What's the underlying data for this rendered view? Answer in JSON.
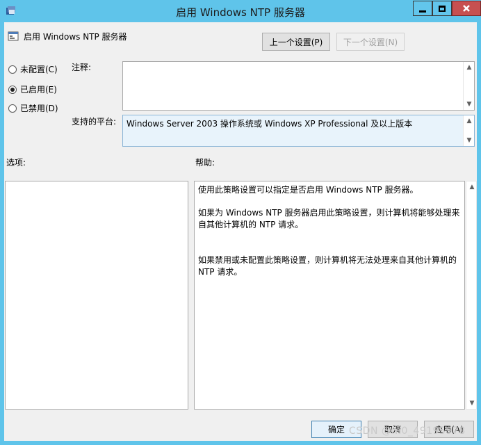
{
  "window": {
    "title": "启用 Windows NTP 服务器"
  },
  "policy": {
    "name": "启用 Windows NTP 服务器",
    "prev_button": "上一个设置(P)",
    "next_button": "下一个设置(N)"
  },
  "options": {
    "not_configured": "未配置(C)",
    "enabled": "已启用(E)",
    "disabled": "已禁用(D)",
    "selected": "enabled"
  },
  "labels": {
    "comment": "注释:",
    "supported_on": "支持的平台:",
    "options": "选项:",
    "help": "帮助:"
  },
  "supported_platform_text": "Windows Server 2003 操作系统或 Windows XP Professional 及以上版本",
  "help_text": [
    "使用此策略设置可以指定是否启用 Windows NTP 服务器。",
    "如果为 Windows NTP 服务器启用此策略设置，则计算机将能够处理来自其他计算机的 NTP 请求。",
    "如果禁用或未配置此策略设置，则计算机将无法处理来自其他计算机的 NTP 请求。"
  ],
  "footer": {
    "ok": "确定",
    "cancel": "取消",
    "apply": "应用(A)"
  },
  "watermark": "CSDN @m0_49195978",
  "icons": {
    "app": "group-policy-icon",
    "policy": "policy-setting-icon",
    "minimize": "minimize-icon",
    "maximize": "maximize-icon",
    "close": "close-icon"
  }
}
